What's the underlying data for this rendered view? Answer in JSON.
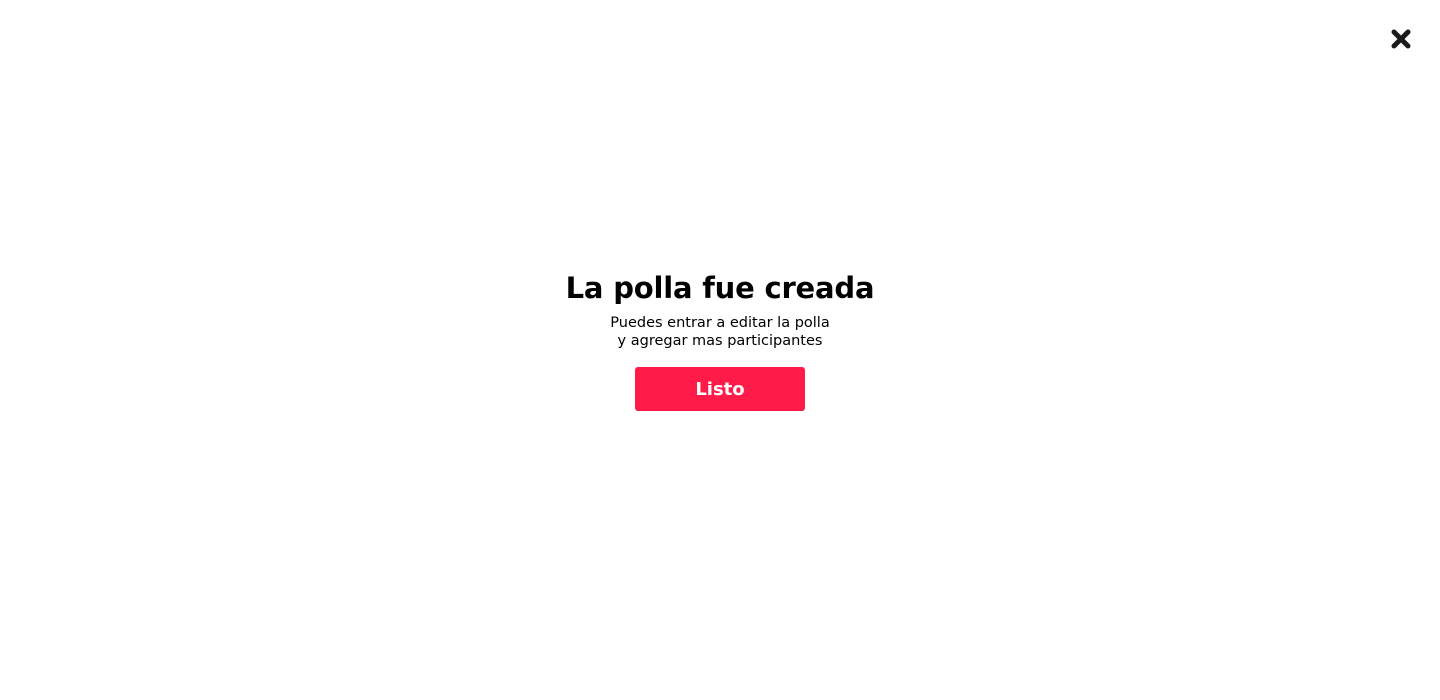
{
  "close": {
    "icon": "close-icon"
  },
  "dialog": {
    "title": "La polla fue creada",
    "message_line1": "Puedes entrar a editar la polla",
    "message_line2": "y agregar mas participantes",
    "button_label": "Listo"
  },
  "colors": {
    "accent": "#ff1a47",
    "text": "#000000",
    "icon": "#1a1a1a",
    "background": "#ffffff"
  }
}
